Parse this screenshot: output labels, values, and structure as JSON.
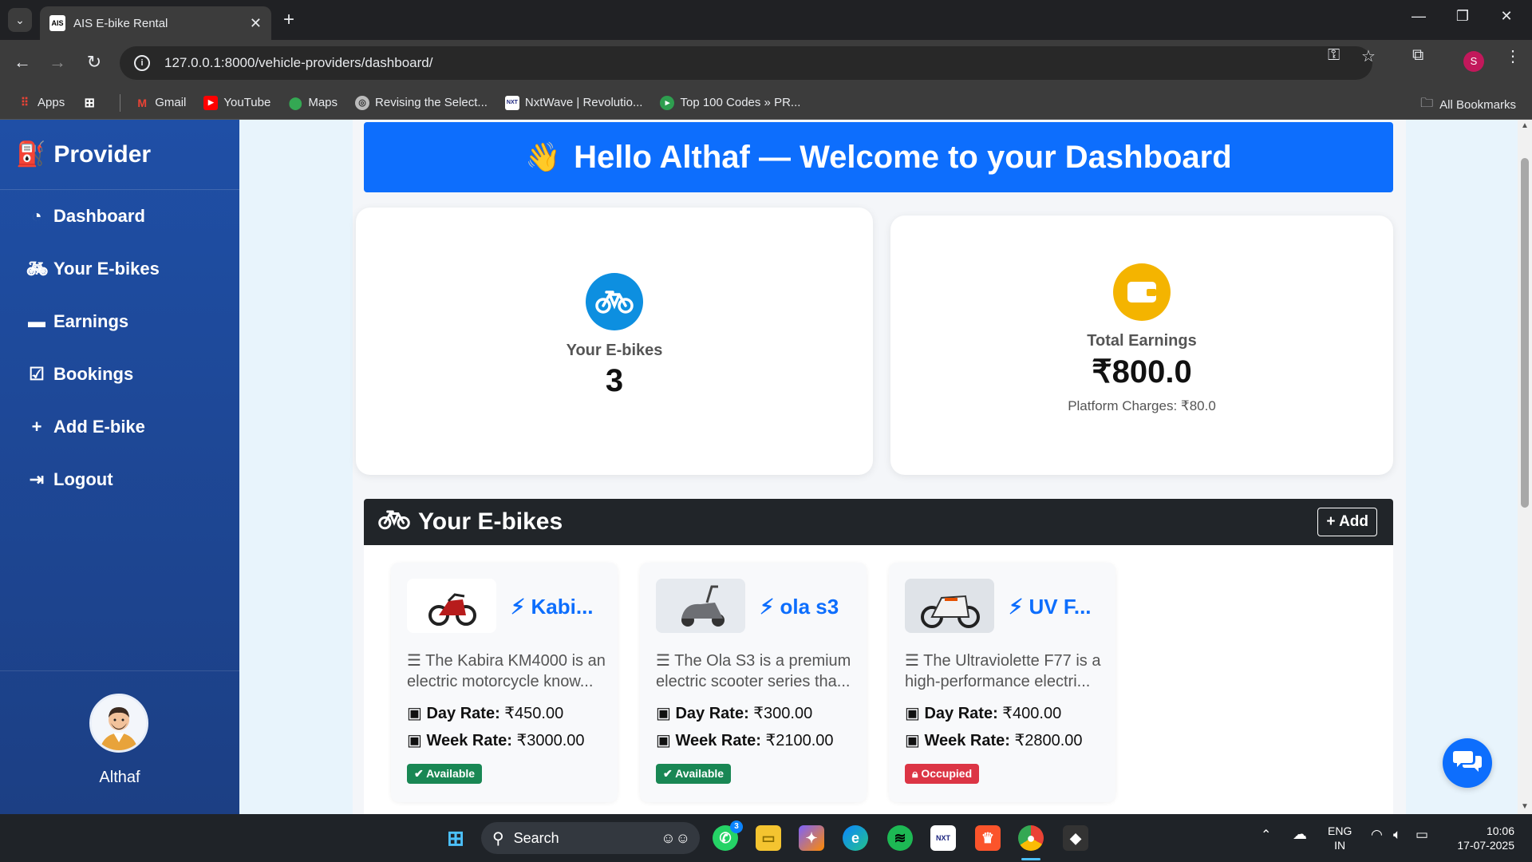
{
  "browser": {
    "tab_title": "AIS E-bike Rental",
    "tab_favicon": "AIS",
    "url": "127.0.0.1:8000/vehicle-providers/dashboard/",
    "profile_initial": "S",
    "bookmarks": [
      "Apps",
      "Gmail",
      "YouTube",
      "Maps",
      "Revising the Select...",
      "NxtWave | Revolutio...",
      "Top 100 Codes » PR..."
    ],
    "all_bookmarks": "All Bookmarks"
  },
  "sidebar": {
    "brand": "Provider",
    "items": [
      {
        "label": "Dashboard",
        "icon": "gauge-icon"
      },
      {
        "label": "Your E-bikes",
        "icon": "bicycle-icon"
      },
      {
        "label": "Earnings",
        "icon": "wallet-icon"
      },
      {
        "label": "Bookings",
        "icon": "calendar-check-icon"
      },
      {
        "label": "Add E-bike",
        "icon": "plus-icon"
      },
      {
        "label": "Logout",
        "icon": "logout-icon"
      }
    ],
    "user_name": "Althaf"
  },
  "main": {
    "hero": "Hello Althaf — Welcome to your Dashboard",
    "stats": {
      "ebikes_label": "Your E-bikes",
      "ebikes_value": "3",
      "earnings_label": "Total Earnings",
      "earnings_value": "₹800.0",
      "platform_charges": "Platform Charges: ₹80.0"
    },
    "ebikes_section": {
      "title": "Your E-bikes",
      "add_label": "Add",
      "bikes": [
        {
          "name": "Kabi...",
          "desc": "The Kabira KM4000 is an electric motorcycle know...",
          "day_label": "Day Rate:",
          "day_rate": "₹450.00",
          "week_label": "Week Rate:",
          "week_rate": "₹3000.00",
          "status": "Available"
        },
        {
          "name": "ola s3",
          "desc": "The Ola S3 is a premium electric scooter series tha...",
          "day_label": "Day Rate:",
          "day_rate": "₹300.00",
          "week_label": "Week Rate:",
          "week_rate": "₹2100.00",
          "status": "Available"
        },
        {
          "name": "UV F...",
          "desc": "The Ultraviolette F77 is a high-performance electri...",
          "day_label": "Day Rate:",
          "day_rate": "₹400.00",
          "week_label": "Week Rate:",
          "week_rate": "₹2800.00",
          "status": "Occupied"
        }
      ]
    }
  },
  "taskbar": {
    "search": "Search",
    "lang_top": "ENG",
    "lang_bottom": "IN",
    "time": "10:06",
    "date": "17-07-2025",
    "whatsapp_count": "3"
  },
  "colors": {
    "primary": "#0d6efd",
    "sidebar": "#1f4fa6",
    "available": "#198754",
    "occupied": "#dc3545",
    "earnings_accent": "#f4b400"
  }
}
